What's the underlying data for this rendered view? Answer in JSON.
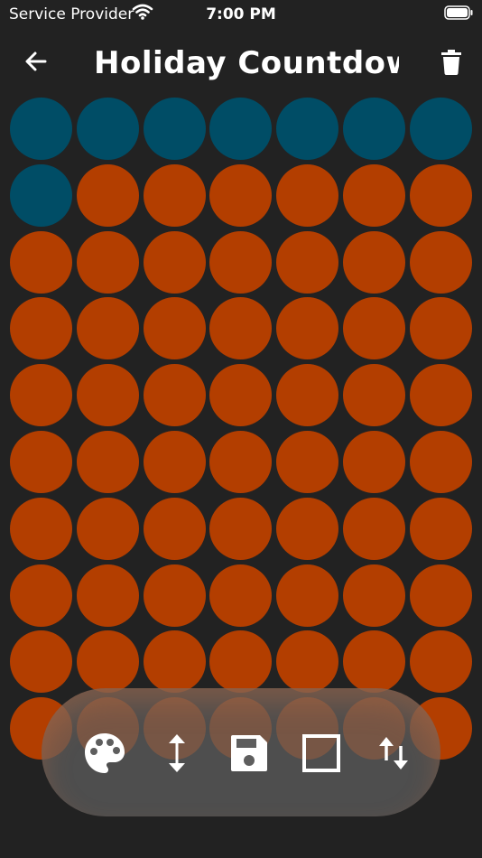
{
  "status": {
    "carrier": "Service Provider",
    "time": "7:00 PM"
  },
  "header": {
    "title": "Holiday Countdown",
    "back_icon": "arrow-left-icon",
    "delete_icon": "trash-icon"
  },
  "grid": {
    "columns": 7,
    "rows": 10,
    "highlighted_count": 8,
    "colors": {
      "highlighted": "#004D66",
      "remaining": "#B33E00"
    }
  },
  "toolbar": {
    "icons": [
      "palette-icon",
      "vertical-resize-icon",
      "save-icon",
      "square-outline-icon",
      "sort-icon"
    ]
  }
}
